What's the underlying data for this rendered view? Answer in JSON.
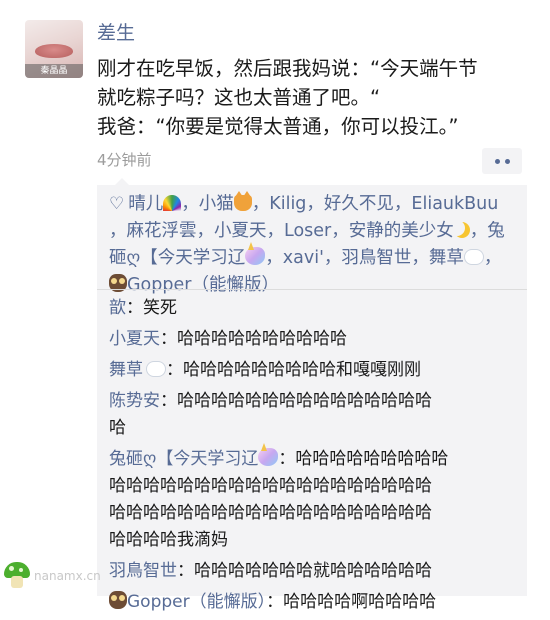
{
  "post": {
    "avatar_tag": "秦晶晶",
    "username": "差生",
    "lines": [
      "刚才在吃早饭，然后跟我妈说：“今天端午节",
      "就吃粽子吗？这也太普通了吧。“",
      "我爸：“你要是觉得太普通，你可以投江。”"
    ],
    "time": "4分钟前"
  },
  "likes": {
    "heart_icon": "♡",
    "line1": {
      "a": "晴儿",
      "b": "，小猫",
      "c": "，Kilig，好久不见，EliaukBuu"
    },
    "line2": {
      "a": "，麻花浮雲，小夏天，Loser，安静的美少女",
      "b": "，兔"
    },
    "line3": {
      "a": "砸ღ【今天学习辽",
      "b": "，xavi'，羽鳥智世，舞草",
      "c": "，"
    },
    "line4": {
      "a": "Gopper（能懈版）"
    }
  },
  "comments": [
    {
      "name": "歆",
      "lines": [
        "：笑死"
      ]
    },
    {
      "name": "小夏天",
      "lines": [
        "：哈哈哈哈哈哈哈哈哈哈"
      ]
    },
    {
      "name": "舞草",
      "lines": [
        "：哈哈哈哈哈哈哈哈哈和嘎嘎刚刚"
      ]
    },
    {
      "name": "陈势安",
      "lines": [
        "：哈哈哈哈哈哈哈哈哈哈哈哈哈哈哈",
        "哈"
      ]
    },
    {
      "name": "兔砸ღ【今天学习辽",
      "lines": [
        "：哈哈哈哈哈哈哈哈哈",
        "哈哈哈哈哈哈哈哈哈哈哈哈哈哈哈哈哈哈哈",
        "哈哈哈哈哈哈哈哈哈哈哈哈哈哈哈哈哈哈哈",
        "哈哈哈哈我滴妈"
      ]
    },
    {
      "name": "羽鳥智世",
      "lines": [
        "：哈哈哈哈哈哈哈就哈哈哈哈哈哈"
      ]
    },
    {
      "name": "Gopper（能懈版）",
      "lines": [
        "：哈哈哈哈啊哈哈哈哈"
      ]
    }
  ],
  "watermark": {
    "text": "nanamx.cn"
  },
  "colors": {
    "link": "#576b95",
    "box_bg": "#f3f3f5",
    "time": "#9c9c9c"
  },
  "icons": [
    "heart-icon",
    "more-dots-icon",
    "rainbow-emoji",
    "cat-emoji",
    "moon-emoji",
    "unicorn-emoji",
    "cloud-emoji",
    "owl-emoji"
  ]
}
